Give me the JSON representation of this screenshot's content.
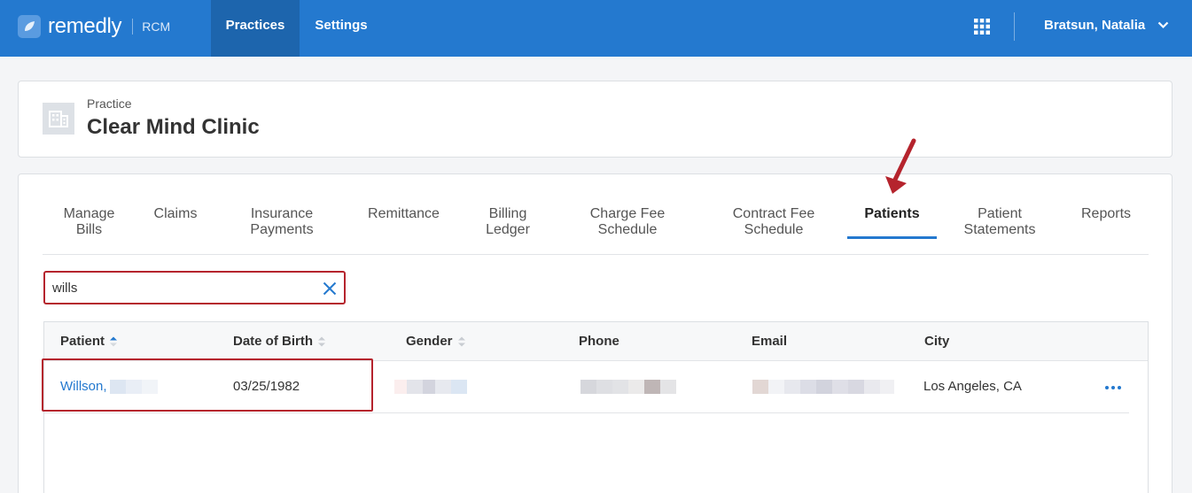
{
  "header": {
    "logo_text": "remedly",
    "logo_sub": "RCM",
    "nav": [
      {
        "label": "Practices"
      },
      {
        "label": "Settings"
      }
    ],
    "user_name": "Bratsun, Natalia"
  },
  "practice": {
    "label": "Practice",
    "name": "Clear Mind Clinic"
  },
  "tabs": [
    {
      "label": "Manage\nBills"
    },
    {
      "label": "Claims"
    },
    {
      "label": "Insurance\nPayments"
    },
    {
      "label": "Remittance"
    },
    {
      "label": "Billing\nLedger"
    },
    {
      "label": "Charge Fee\nSchedule"
    },
    {
      "label": "Contract Fee\nSchedule"
    },
    {
      "label": "Patients",
      "active": true
    },
    {
      "label": "Patient\nStatements"
    },
    {
      "label": "Reports"
    }
  ],
  "search": {
    "value": "wills"
  },
  "table": {
    "columns": [
      "Patient",
      "Date of Birth",
      "Gender",
      "Phone",
      "Email",
      "City"
    ],
    "sort": {
      "column": "Patient",
      "direction": "asc"
    },
    "rows": [
      {
        "patient": "Willson,",
        "dob": "03/25/1982",
        "city": "Los Angeles, CA"
      }
    ]
  },
  "colors": {
    "brand": "#2479cf",
    "brand_dark": "#1d65ad",
    "annotation": "#b5242d"
  },
  "icons": [
    "logo-leaf-icon",
    "apps-grid-icon",
    "chevron-down-icon",
    "building-icon",
    "close-icon",
    "sort-icon",
    "more-icon",
    "annotation-arrow"
  ]
}
